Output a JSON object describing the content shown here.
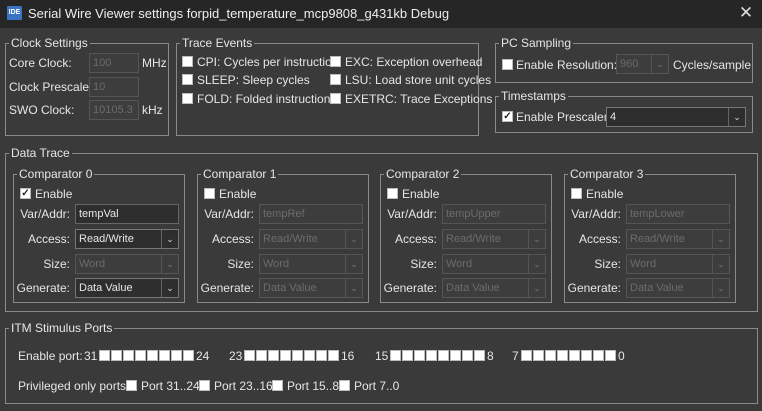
{
  "window": {
    "title": "Serial Wire Viewer settings forpid_temperature_mcp9808_g431kb Debug",
    "app_icon": "IDE"
  },
  "clock": {
    "legend": "Clock Settings",
    "core_label": "Core Clock:",
    "core_value": "100",
    "core_unit": "MHz",
    "prescaler_label": "Clock Prescaler:",
    "prescaler_value": "10",
    "swo_label": "SWO Clock:",
    "swo_value": "10105.3",
    "swo_unit": "kHz"
  },
  "trace_events": {
    "legend": "Trace Events",
    "cpi": "CPI: Cycles per instruction",
    "sleep": "SLEEP: Sleep cycles",
    "fold": "FOLD: Folded instructions",
    "exc": "EXC: Exception overhead",
    "lsu": "LSU: Load store unit cycles",
    "exetrc": "EXETRC: Trace Exceptions"
  },
  "pc_sampling": {
    "legend": "PC Sampling",
    "enable": "Enable",
    "resolution_label": "Resolution:",
    "resolution_value": "960",
    "unit": "Cycles/sample"
  },
  "timestamps": {
    "legend": "Timestamps",
    "enable": "Enable",
    "prescaler_label": "Prescaler:",
    "prescaler_value": "4"
  },
  "data_trace": {
    "legend": "Data Trace",
    "labels": {
      "enable": "Enable",
      "var": "Var/Addr:",
      "access": "Access:",
      "size": "Size:",
      "generate": "Generate:"
    },
    "comparators": [
      {
        "title": "Comparator 0",
        "enabled": true,
        "var": "tempVal",
        "access": "Read/Write",
        "size": "Word",
        "generate": "Data Value"
      },
      {
        "title": "Comparator 1",
        "enabled": false,
        "var": "tempRef",
        "access": "Read/Write",
        "size": "Word",
        "generate": "Data Value"
      },
      {
        "title": "Comparator 2",
        "enabled": false,
        "var": "tempUpper",
        "access": "Read/Write",
        "size": "Word",
        "generate": "Data Value"
      },
      {
        "title": "Comparator 3",
        "enabled": false,
        "var": "tempLower",
        "access": "Read/Write",
        "size": "Word",
        "generate": "Data Value"
      }
    ]
  },
  "itm": {
    "legend": "ITM Stimulus Ports",
    "enable_label": "Enable port:",
    "groups": [
      {
        "hi": "31",
        "lo": "24"
      },
      {
        "hi": "23",
        "lo": "16"
      },
      {
        "hi": "15",
        "lo": "8"
      },
      {
        "hi": "7",
        "lo": "0"
      }
    ],
    "priv_label": "Privileged only ports:",
    "priv_ports": [
      "Port 31..24",
      "Port 23..16",
      "Port 15..8",
      "Port 7..0"
    ]
  }
}
